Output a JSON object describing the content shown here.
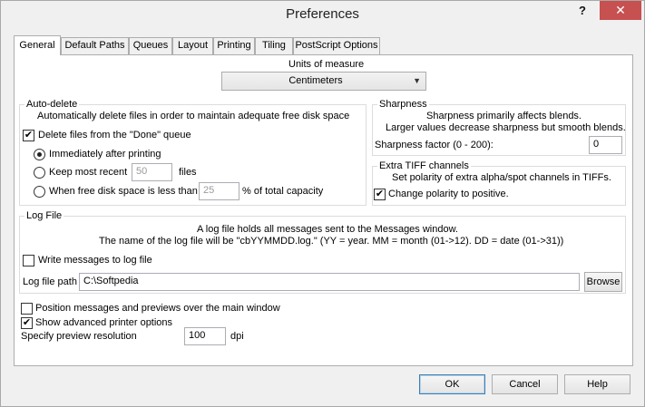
{
  "window": {
    "title": "Preferences",
    "help_glyph": "?",
    "close_glyph": "✕"
  },
  "tabs": [
    {
      "label": "General"
    },
    {
      "label": "Default Paths"
    },
    {
      "label": "Queues"
    },
    {
      "label": "Layout"
    },
    {
      "label": "Printing"
    },
    {
      "label": "Tiling"
    },
    {
      "label": "PostScript Options"
    }
  ],
  "units": {
    "label": "Units of measure",
    "value": "Centimeters"
  },
  "autodelete": {
    "title": "Auto-delete",
    "description": "Automatically delete files in order to maintain adequate free disk space",
    "delete_done_label": "Delete files from the \"Done\" queue",
    "delete_done_checked": true,
    "opt_immediately": "Immediately after printing",
    "opt_keep_recent": "Keep most recent",
    "keep_recent_value": "50",
    "keep_recent_unit": "files",
    "opt_free_space": "When free disk space is less than",
    "free_space_value": "25",
    "free_space_unit": "% of total capacity",
    "selected": "immediately"
  },
  "sharpness": {
    "title": "Sharpness",
    "line1": "Sharpness primarily affects blends.",
    "line2": "Larger values decrease sharpness but smooth blends.",
    "factor_label": "Sharpness factor (0 - 200):",
    "factor_value": "0"
  },
  "tiff": {
    "title": "Extra TIFF channels",
    "description": "Set polarity of extra alpha/spot channels in TIFFs.",
    "change_polarity_label": "Change polarity to positive.",
    "change_polarity_checked": true
  },
  "logfile": {
    "title": "Log File",
    "line1": "A log file holds all messages sent to the Messages window.",
    "line2": "The name of the log file will be \"cbYYMMDD.log.\" (YY = year. MM = month (01->12). DD = date (01->31))",
    "write_label": "Write messages to log file",
    "write_checked": false,
    "path_label": "Log file path",
    "path_value": "C:\\Softpedia",
    "browse_label": "Browse"
  },
  "options": {
    "position_label": "Position messages and previews over the main window",
    "position_checked": false,
    "advanced_label": "Show advanced printer options",
    "advanced_checked": true,
    "resolution_label": "Specify preview resolution",
    "resolution_value": "100",
    "resolution_unit": "dpi"
  },
  "buttons": {
    "ok": "OK",
    "cancel": "Cancel",
    "help": "Help"
  },
  "check_glyph": "✔",
  "dropdown_glyph": "▼"
}
